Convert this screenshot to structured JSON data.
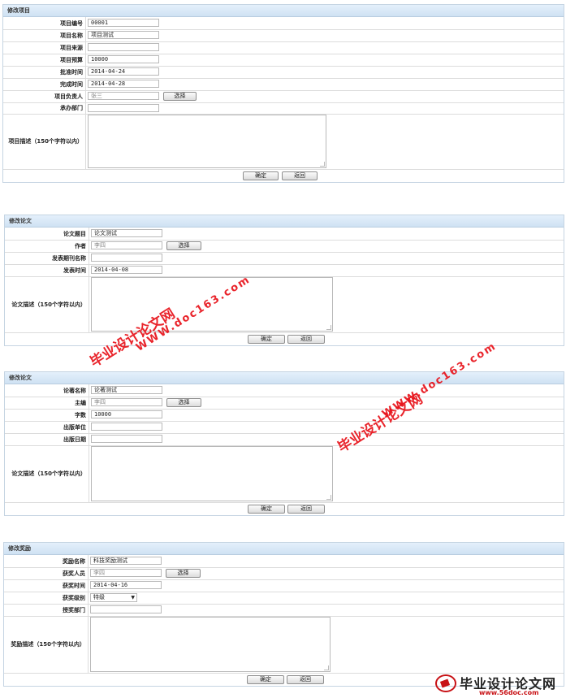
{
  "project": {
    "title": "修改项目",
    "fields": [
      {
        "label": "项目编号",
        "value": "00001"
      },
      {
        "label": "项目名称",
        "value": "项目测试"
      },
      {
        "label": "项目来源",
        "value": ""
      },
      {
        "label": "项目预算",
        "value": "10000"
      },
      {
        "label": "批准时间",
        "value": "2014-04-24"
      },
      {
        "label": "完成时间",
        "value": "2014-04-28"
      },
      {
        "label": "项目负责人",
        "value": "张三",
        "button": "选择"
      },
      {
        "label": "承办部门",
        "value": ""
      }
    ],
    "desc_label": "项目描述（150个字符以内）",
    "ok": "确定",
    "back": "返回"
  },
  "paper": {
    "title": "修改论文",
    "fields": [
      {
        "label": "论文题目",
        "value": "论文测试"
      },
      {
        "label": "作者",
        "value": "李四",
        "button": "选择"
      },
      {
        "label": "发表期刊名称",
        "value": ""
      },
      {
        "label": "发表时间",
        "value": "2014-04-08"
      }
    ],
    "desc_label": "论文描述（150个字符以内）",
    "ok": "确定",
    "back": "返回"
  },
  "book": {
    "title": "修改论文",
    "fields": [
      {
        "label": "论著名称",
        "value": "论著测试"
      },
      {
        "label": "主编",
        "value": "李四",
        "button": "选择"
      },
      {
        "label": "字数",
        "value": "10000"
      },
      {
        "label": "出版单位",
        "value": ""
      },
      {
        "label": "出版日期",
        "value": ""
      }
    ],
    "desc_label": "论文描述（150个字符以内）",
    "ok": "确定",
    "back": "返回"
  },
  "award": {
    "title": "修改奖励",
    "fields": [
      {
        "label": "奖励名称",
        "value": "科技奖励测试"
      },
      {
        "label": "获奖人员",
        "value": "李四",
        "button": "选择"
      },
      {
        "label": "获奖时间",
        "value": "2014-04-16"
      },
      {
        "label": "获奖级别",
        "value": "特级"
      },
      {
        "label": "授奖部门",
        "value": ""
      }
    ],
    "desc_label": "奖励描述（150个字符以内）",
    "ok": "确定",
    "back": "返回"
  },
  "watermarks": {
    "cn": "毕业设计论文网",
    "url": "WWW.doc163.com"
  },
  "logo": {
    "cn": "毕业设计论文网",
    "url": "www.56doc.com"
  },
  "colors": {
    "title_bar": "#d6e7f7",
    "watermark": "#e8121a"
  }
}
